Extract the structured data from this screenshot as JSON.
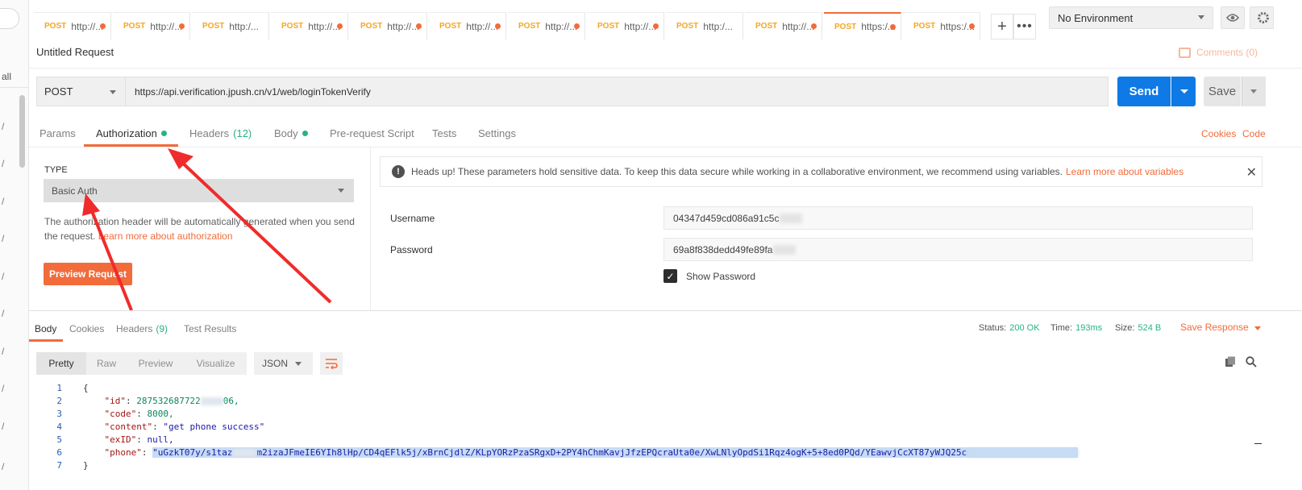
{
  "sidebar": {
    "all_label": "all",
    "slashes": [
      "/",
      "/",
      "/",
      "/",
      "/",
      "/",
      "/",
      "/",
      "/",
      "/",
      "/"
    ]
  },
  "tabs": [
    {
      "method": "POST",
      "url": "http://..."
    },
    {
      "method": "POST",
      "url": "http://..."
    },
    {
      "method": "POST",
      "url": "http:/..."
    },
    {
      "method": "POST",
      "url": "http://..."
    },
    {
      "method": "POST",
      "url": "http://..."
    },
    {
      "method": "POST",
      "url": "http://..."
    },
    {
      "method": "POST",
      "url": "http://..."
    },
    {
      "method": "POST",
      "url": "http://..."
    },
    {
      "method": "POST",
      "url": "http:/..."
    },
    {
      "method": "POST",
      "url": "http://..."
    },
    {
      "method": "POST",
      "url": "https:/..."
    },
    {
      "method": "POST",
      "url": "https:/..."
    }
  ],
  "environment": {
    "selected": "No Environment"
  },
  "request": {
    "title": "Untitled Request",
    "comments": "Comments (0)",
    "method": "POST",
    "url": "https://api.verification.jpush.cn/v1/web/loginTokenVerify",
    "send_label": "Send",
    "save_label": "Save"
  },
  "request_tabs": {
    "params": "Params",
    "authorization": "Authorization",
    "headers": "Headers",
    "headers_count": "(12)",
    "body": "Body",
    "prerequest": "Pre-request Script",
    "tests": "Tests",
    "settings": "Settings",
    "cookies": "Cookies",
    "code": "Code"
  },
  "auth": {
    "type_label": "TYPE",
    "type_value": "Basic Auth",
    "description": "The authorization header will be automatically generated when you send the request.",
    "learn_more": "Learn more about authorization",
    "preview_button": "Preview Request",
    "notice": "Heads up! These parameters hold sensitive data. To keep this data secure while working in a collaborative environment, we recommend using variables.",
    "notice_link": "Learn more about variables",
    "username_label": "Username",
    "username_value": "04347d459cd086a91c5c",
    "password_label": "Password",
    "password_value": "69a8f838dedd49fe89fa",
    "show_password": "Show Password"
  },
  "response": {
    "tabs": {
      "body": "Body",
      "cookies": "Cookies",
      "headers": "Headers",
      "headers_count": "(9)",
      "tests": "Test Results"
    },
    "status_label": "Status:",
    "status_value": "200 OK",
    "time_label": "Time:",
    "time_value": "193ms",
    "size_label": "Size:",
    "size_value": "524 B",
    "save_response": "Save Response",
    "formats": [
      "Pretty",
      "Raw",
      "Preview",
      "Visualize"
    ],
    "language": "JSON",
    "lines": {
      "id_key": "\"id\"",
      "id_val_a": "287532687722",
      "id_val_b": "06,",
      "code_key": "\"code\"",
      "code_val": "8000,",
      "content_key": "\"content\"",
      "content_val": "\"get phone success\"",
      "exid_key": "\"exID\"",
      "exid_val": "null,",
      "phone_key": "\"phone\"",
      "phone_a": "\"uGzkT07y/s1taz",
      "phone_b": "m2izaJFmeIE6YIh8lHp/CD4qEFlk5j/xBrnCjdlZ/KLpYORzPzaSRgxD+2PY4hChmKavjJfzEPQcraUta0e/XwLNlyOpdSi1Rqz4ogK+5+8ed0PQd/YEawvjCcXT87yWJQ25c"
    }
  }
}
